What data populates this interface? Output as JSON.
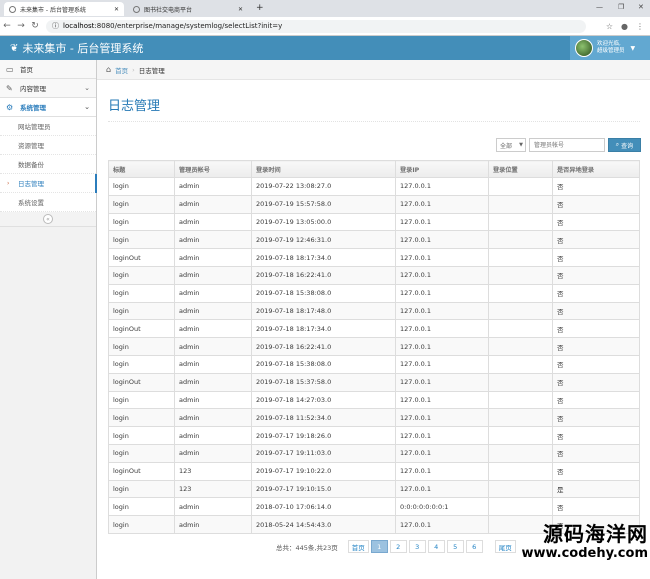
{
  "browser": {
    "tabs": [
      {
        "title": "未来集市 - 后台管理系统"
      },
      {
        "title": "图书社交电商平台"
      }
    ],
    "url_host": "localhost",
    "url_rest": ":8080/enterprise/manage/systemlog/selectList?init=y"
  },
  "app": {
    "title": "未来集市 - 后台管理系统",
    "user_line1": "欢迎光临,",
    "user_line2": "超级管理员"
  },
  "sidebar": {
    "items": [
      {
        "label": "首页"
      },
      {
        "label": "内容管理"
      },
      {
        "label": "系统管理"
      }
    ],
    "subitems": [
      {
        "label": "网站管理员"
      },
      {
        "label": "资源管理"
      },
      {
        "label": "数据备份"
      },
      {
        "label": "日志管理"
      },
      {
        "label": "系统设置"
      }
    ]
  },
  "breadcrumb": {
    "home": "首页",
    "current": "日志管理"
  },
  "page": {
    "title": "日志管理"
  },
  "filter": {
    "select_value": "全部",
    "input_placeholder": "管理员帐号",
    "search_label": "查询"
  },
  "table": {
    "headers": [
      "标题",
      "管理员帐号",
      "登录时间",
      "登录IP",
      "登录位置",
      "是否异地登录"
    ],
    "rows": [
      [
        "login",
        "admin",
        "2019-07-22 13:08:27.0",
        "127.0.0.1",
        "",
        "否"
      ],
      [
        "login",
        "admin",
        "2019-07-19 15:57:58.0",
        "127.0.0.1",
        "",
        "否"
      ],
      [
        "login",
        "admin",
        "2019-07-19 13:05:00.0",
        "127.0.0.1",
        "",
        "否"
      ],
      [
        "login",
        "admin",
        "2019-07-19 12:46:31.0",
        "127.0.0.1",
        "",
        "否"
      ],
      [
        "loginOut",
        "admin",
        "2019-07-18 18:17:34.0",
        "127.0.0.1",
        "",
        "否"
      ],
      [
        "login",
        "admin",
        "2019-07-18 16:22:41.0",
        "127.0.0.1",
        "",
        "否"
      ],
      [
        "login",
        "admin",
        "2019-07-18 15:38:08.0",
        "127.0.0.1",
        "",
        "否"
      ],
      [
        "login",
        "admin",
        "2019-07-18 18:17:48.0",
        "127.0.0.1",
        "",
        "否"
      ],
      [
        "loginOut",
        "admin",
        "2019-07-18 18:17:34.0",
        "127.0.0.1",
        "",
        "否"
      ],
      [
        "login",
        "admin",
        "2019-07-18 16:22:41.0",
        "127.0.0.1",
        "",
        "否"
      ],
      [
        "login",
        "admin",
        "2019-07-18 15:38:08.0",
        "127.0.0.1",
        "",
        "否"
      ],
      [
        "loginOut",
        "admin",
        "2019-07-18 15:37:58.0",
        "127.0.0.1",
        "",
        "否"
      ],
      [
        "login",
        "admin",
        "2019-07-18 14:27:03.0",
        "127.0.0.1",
        "",
        "否"
      ],
      [
        "login",
        "admin",
        "2019-07-18 11:52:34.0",
        "127.0.0.1",
        "",
        "否"
      ],
      [
        "login",
        "admin",
        "2019-07-17 19:18:26.0",
        "127.0.0.1",
        "",
        "否"
      ],
      [
        "login",
        "admin",
        "2019-07-17 19:11:03.0",
        "127.0.0.1",
        "",
        "否"
      ],
      [
        "loginOut",
        "123",
        "2019-07-17 19:10:22.0",
        "127.0.0.1",
        "",
        "否"
      ],
      [
        "login",
        "123",
        "2019-07-17 19:10:15.0",
        "127.0.0.1",
        "",
        "是"
      ],
      [
        "login",
        "admin",
        "2018-07-10 17:06:14.0",
        "0:0:0:0:0:0:0:1",
        "",
        "否"
      ],
      [
        "login",
        "admin",
        "2018-05-24 14:54:43.0",
        "127.0.0.1",
        "",
        "否"
      ]
    ]
  },
  "pager": {
    "total": "总共：445条,共23页",
    "first": "首页",
    "pages": [
      "1",
      "2",
      "3",
      "4",
      "5",
      "6"
    ],
    "last": "尾页"
  },
  "watermark": {
    "line1": "源码海洋网",
    "line2": "www.codehy.com"
  }
}
